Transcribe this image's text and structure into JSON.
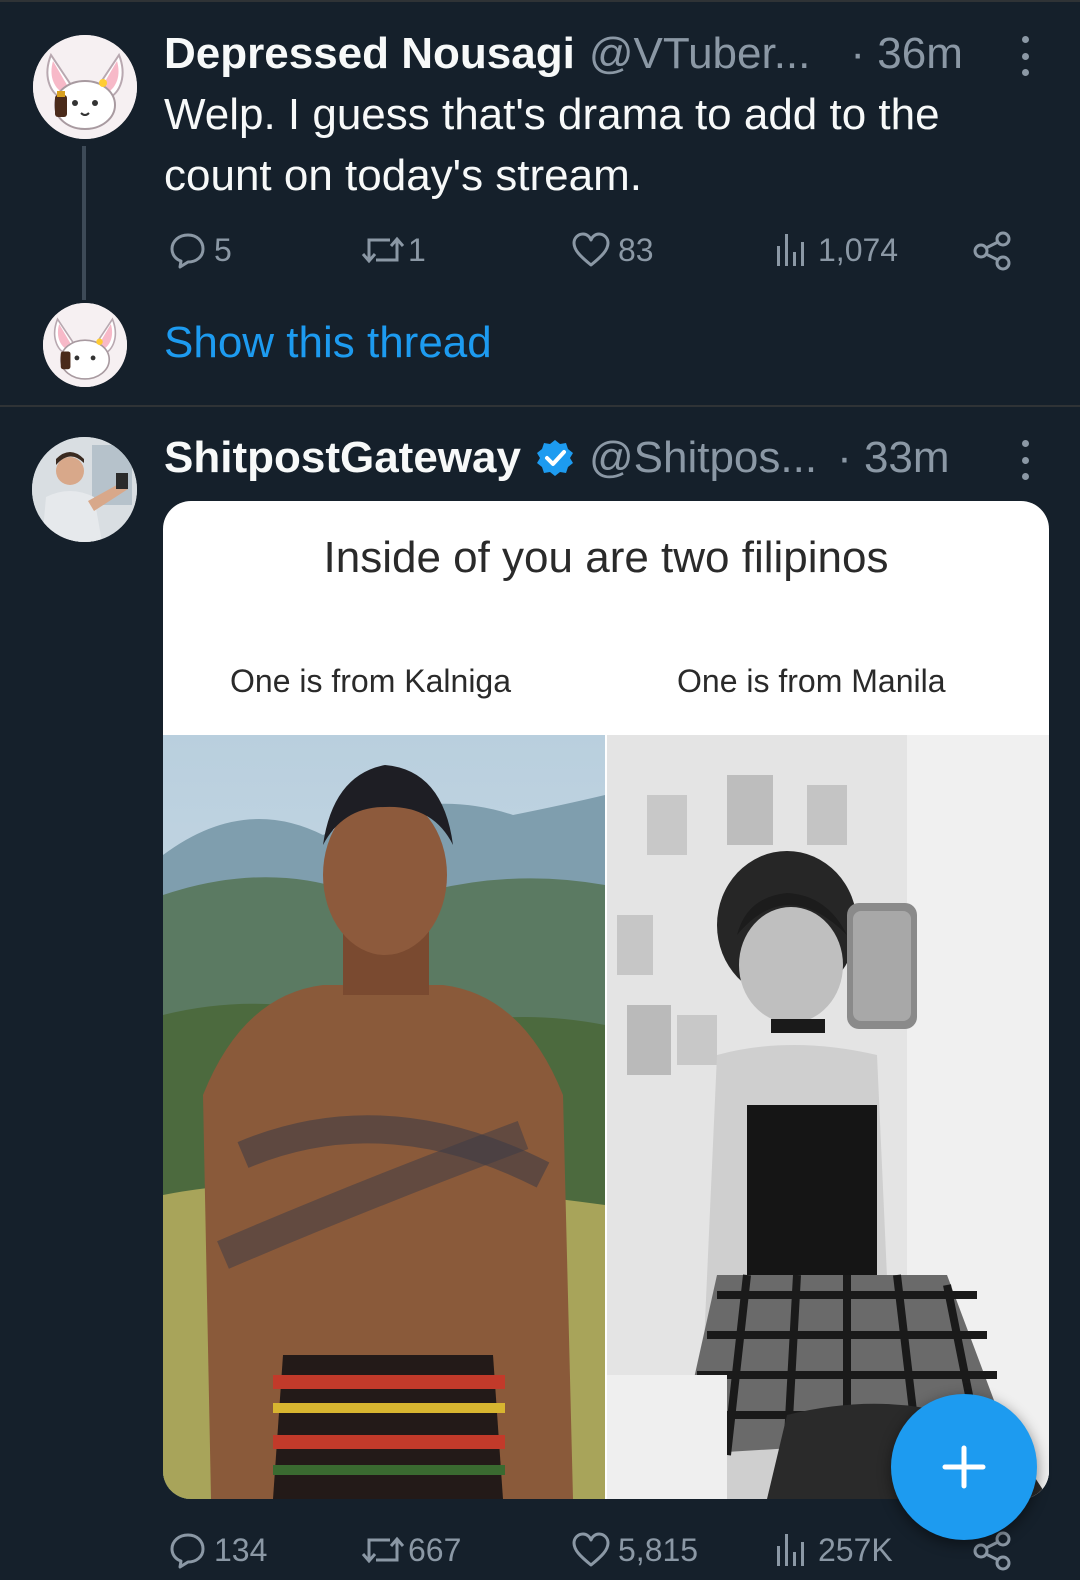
{
  "tweets": [
    {
      "author_name": "Depressed Nousagi",
      "handle": "@VTuber...",
      "time": "· 36m",
      "text_line1": "Welp. I guess that's drama to add to the",
      "text_line2": "count on today's stream.",
      "replies": "5",
      "retweets": "1",
      "likes": "83",
      "views": "1,074",
      "show_thread": "Show this thread"
    },
    {
      "author_name": "ShitpostGateway",
      "handle": "@Shitpos...",
      "time": "· 33m",
      "verified": true,
      "media": {
        "title": "Inside of you are two filipinos",
        "left_caption": "One is from Kalniga",
        "right_caption": "One is from Manila"
      },
      "replies": "134",
      "retweets": "667",
      "likes": "5,815",
      "views": "257K"
    }
  ],
  "colors": {
    "background": "#15202b",
    "accent": "#1d9bf0",
    "muted": "#8b98a5",
    "text": "#f7f9f9"
  },
  "icons": [
    "reply-icon",
    "retweet-icon",
    "like-icon",
    "views-icon",
    "share-icon",
    "more-icon",
    "verified-badge-icon",
    "compose-plus-icon"
  ]
}
